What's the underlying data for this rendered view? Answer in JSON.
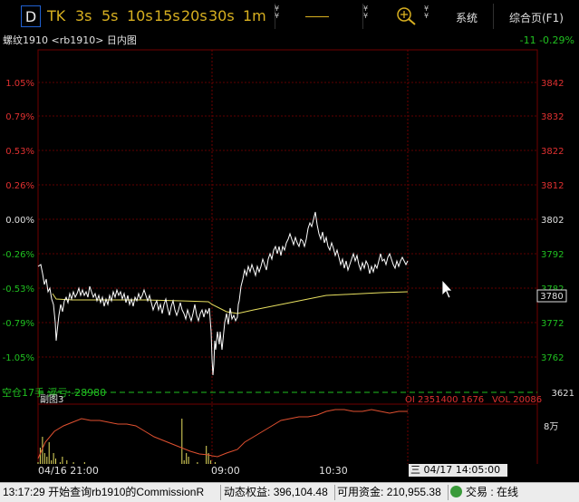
{
  "toolbar": {
    "period_active": "D",
    "periods": [
      "TK",
      "3s",
      "5s",
      "10s",
      "15s",
      "20s",
      "30s",
      "1m"
    ],
    "system_label": "系统",
    "overview_label": "综合页(F1)"
  },
  "chart": {
    "header_left": "螺纹1910 <rb1910> 日内图",
    "header_right": "-11 -0.29%",
    "pct_ticks": [
      "1.05%",
      "0.79%",
      "0.53%",
      "0.26%",
      "0.00%",
      "-0.26%",
      "-0.53%",
      "-0.79%",
      "-1.05%"
    ],
    "price_ticks": [
      "3842",
      "3832",
      "3822",
      "3812",
      "3802",
      "3792",
      "3782",
      "3772",
      "3762"
    ],
    "price_bottom": "3621",
    "current_price_box": "3780",
    "position_info": "空仓17手  浮亏:-28980",
    "sub_label": "副图3",
    "oi_label": "OI 2351400  1676",
    "vol_label": "VOL 20086",
    "vol_axis": "8万",
    "time_labels": [
      "04/16 21:00",
      "09:00",
      "10:30"
    ],
    "time_cursor": "三 04/17 14:05:00"
  },
  "chart_data": {
    "type": "line",
    "ylim": [
      3752,
      3848
    ],
    "sub_ylim_volume": [
      0,
      80000
    ],
    "series": []
  },
  "status": {
    "time": "13:17:29",
    "message": "开始查询rb1910的CommissionR",
    "equity_label": "动态权益:",
    "equity_value": "396,104.48",
    "available_label": "可用资金:",
    "available_value": "210,955.38",
    "trade_label": "交易 : 在线"
  },
  "colors": {
    "up": "#e03030",
    "down": "#20c020",
    "price_line": "#ffffff",
    "avg_line": "#e8e060",
    "volume": "#e8e060",
    "oi_line": "#e05030",
    "grid": "#600000"
  }
}
